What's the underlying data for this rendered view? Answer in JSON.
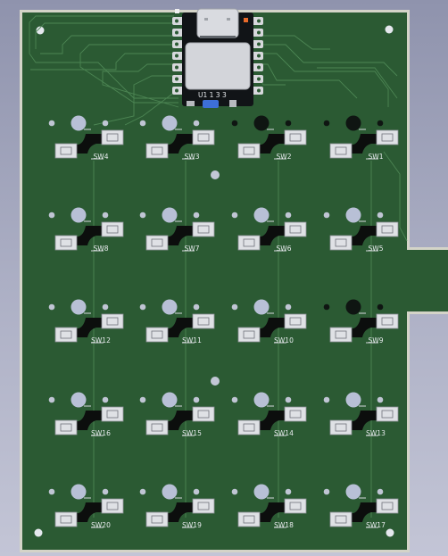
{
  "view": {
    "background_top": "#8f93ad",
    "background_bottom": "#c3c5d6",
    "board_color": "#2b5a33",
    "board_edge_color": "#d4d4c8",
    "trace_color": "#4c8553",
    "silk_color": "#e9ecef",
    "pad_color": "#c9cbd0",
    "hole_color": "#b8c0d6"
  },
  "controller": {
    "silk_text": "U1 1 3 3",
    "leds": [
      "#e86a2a",
      "#e86a2a"
    ],
    "button_color": "#3d6fd8"
  },
  "switches": [
    {
      "ref": "SW4",
      "row": 0,
      "col": 0
    },
    {
      "ref": "SW3",
      "row": 0,
      "col": 1
    },
    {
      "ref": "SW2",
      "row": 0,
      "col": 2
    },
    {
      "ref": "SW1",
      "row": 0,
      "col": 3
    },
    {
      "ref": "SW8",
      "row": 1,
      "col": 0
    },
    {
      "ref": "SW7",
      "row": 1,
      "col": 1
    },
    {
      "ref": "SW6",
      "row": 1,
      "col": 2
    },
    {
      "ref": "SW5",
      "row": 1,
      "col": 3
    },
    {
      "ref": "SW12",
      "row": 2,
      "col": 0
    },
    {
      "ref": "SW11",
      "row": 2,
      "col": 1
    },
    {
      "ref": "SW10",
      "row": 2,
      "col": 2
    },
    {
      "ref": "SW9",
      "row": 2,
      "col": 3
    },
    {
      "ref": "SW16",
      "row": 3,
      "col": 0
    },
    {
      "ref": "SW15",
      "row": 3,
      "col": 1
    },
    {
      "ref": "SW14",
      "row": 3,
      "col": 2
    },
    {
      "ref": "SW13",
      "row": 3,
      "col": 3
    },
    {
      "ref": "SW20",
      "row": 4,
      "col": 0
    },
    {
      "ref": "SW19",
      "row": 4,
      "col": 1
    },
    {
      "ref": "SW18",
      "row": 4,
      "col": 2
    },
    {
      "ref": "SW17",
      "row": 4,
      "col": 3
    }
  ],
  "dark_holes": [
    {
      "row": 0,
      "col": 2
    },
    {
      "row": 0,
      "col": 3
    },
    {
      "row": 2,
      "col": 3
    }
  ]
}
